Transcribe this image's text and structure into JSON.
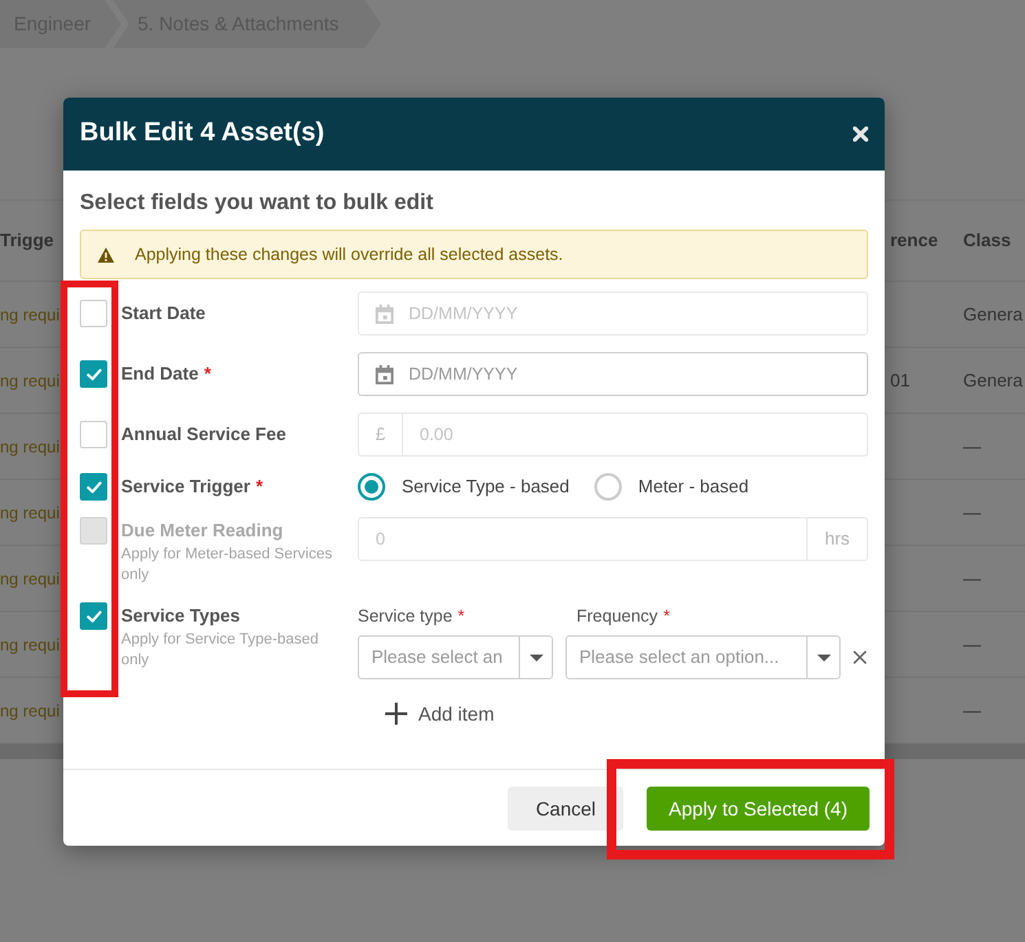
{
  "breadcrumb": [
    {
      "label": "Engineer"
    },
    {
      "label": "5. Notes & Attachments"
    }
  ],
  "table": {
    "columns": [
      "Trigge",
      "rence",
      "Class"
    ],
    "rows": [
      {
        "column_1": "ng requi",
        "column_3": "Genera"
      },
      {
        "column_1": "ng requi",
        "column_2": "01",
        "column_3": "Genera"
      },
      {
        "column_1": "ng requi",
        "column_3": "—"
      },
      {
        "column_1": "ng requi",
        "column_3": "—"
      },
      {
        "column_1": "ng requi",
        "column_3": "—"
      },
      {
        "column_1": "ng requi",
        "column_3": "—"
      },
      {
        "column_1": "ng requi",
        "column_3": "—"
      }
    ]
  },
  "dialog": {
    "title": "Bulk Edit 4 Asset(s)",
    "intro": "Select fields you want to bulk edit",
    "alert": "Applying these changes will override all selected assets.",
    "checkboxes_highlighted": true,
    "fields": [
      {
        "kind": "date",
        "label": "Start Date",
        "checked": false,
        "disabled": false,
        "placeholder": "DD/MM/YYYY"
      },
      {
        "kind": "date",
        "label": "End Date",
        "required_mark": "*",
        "checked": true,
        "disabled": false,
        "placeholder": "DD/MM/YYYY"
      },
      {
        "kind": "currency",
        "label": "Annual Service Fee",
        "checked": false,
        "disabled": false,
        "prefix": "£",
        "placeholder": "0.00"
      },
      {
        "kind": "radio",
        "label": "Service Trigger",
        "required_mark": "*",
        "checked": true,
        "disabled": false,
        "options": [
          {
            "label": "Service Type - based",
            "selected": true
          },
          {
            "label": "Meter - based",
            "selected": false
          }
        ]
      },
      {
        "kind": "number",
        "label": "Due Meter Reading",
        "hint": "Apply for Meter-based Services only",
        "checked": false,
        "disabled": true,
        "placeholder": "0",
        "suffix": "hrs"
      },
      {
        "kind": "list",
        "label": "Service Types",
        "hint": "Apply for Service Type-based only",
        "checked": true,
        "disabled": false,
        "columns": [
          {
            "label": "Service type",
            "required_mark": "*"
          },
          {
            "label": "Frequency",
            "required_mark": "*"
          }
        ],
        "items": [
          {
            "values": [
              {
                "placeholder": "Please select an"
              },
              {
                "placeholder": "Please select an option..."
              }
            ]
          }
        ],
        "add_label": "Add item"
      }
    ],
    "buttons": [
      {
        "kind": "secondary",
        "label": "Cancel",
        "highlighted": false
      },
      {
        "kind": "primary",
        "label": "Apply to Selected (4)",
        "highlighted": true
      }
    ]
  }
}
